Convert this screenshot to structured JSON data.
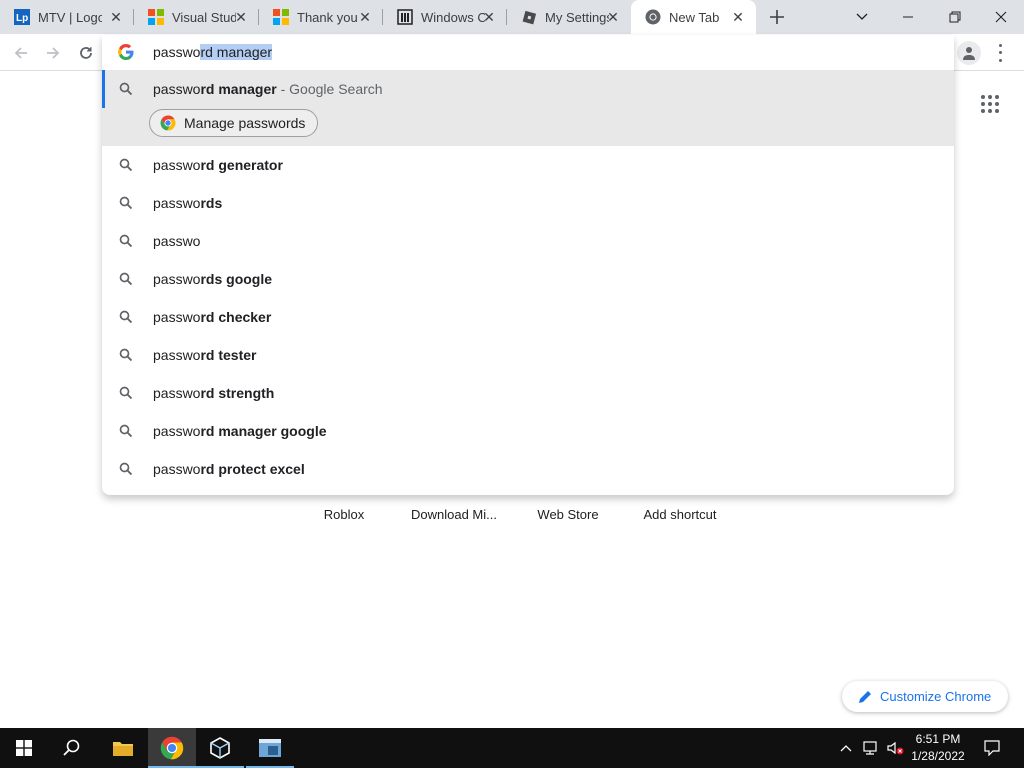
{
  "tabs": [
    {
      "title": "MTV | Logo",
      "icon": "lp-logo-icon"
    },
    {
      "title": "Visual Studio",
      "icon": "microsoft-logo-icon"
    },
    {
      "title": "Thank you",
      "icon": "microsoft-logo-icon"
    },
    {
      "title": "Windows C",
      "icon": "building-icon"
    },
    {
      "title": "My Settings",
      "icon": "roblox-icon"
    },
    {
      "title": "New Tab",
      "icon": "chrome-icon",
      "active": true
    }
  ],
  "omnibox": {
    "typed": "passwo",
    "autocomplete": "rd manager"
  },
  "suggestions": [
    {
      "typed": "passwo",
      "bold": "rd manager",
      "desc": " - Google Search",
      "selected": true
    },
    {
      "typed": "passwo",
      "bold": "rd generator"
    },
    {
      "typed": "passwo",
      "bold": "rds"
    },
    {
      "typed": "passwo",
      "bold": ""
    },
    {
      "typed": "passwo",
      "bold": "rds google"
    },
    {
      "typed": "passwo",
      "bold": "rd checker"
    },
    {
      "typed": "passwo",
      "bold": "rd tester"
    },
    {
      "typed": "passwo",
      "bold": "rd strength"
    },
    {
      "typed": "passwo",
      "bold": "rd manager google"
    },
    {
      "typed": "passwo",
      "bold": "rd protect excel"
    }
  ],
  "action_chip": {
    "label": "Manage passwords"
  },
  "shortcuts": [
    "Roblox",
    "Download Mi...",
    "Web Store",
    "Add shortcut"
  ],
  "customize": {
    "label": "Customize Chrome"
  },
  "clock": {
    "time": "6:51 PM",
    "date": "1/28/2022"
  },
  "colors": {
    "accent": "#1a73e8",
    "tabstrip": "#dee1e6",
    "taskbar": "#101010"
  }
}
